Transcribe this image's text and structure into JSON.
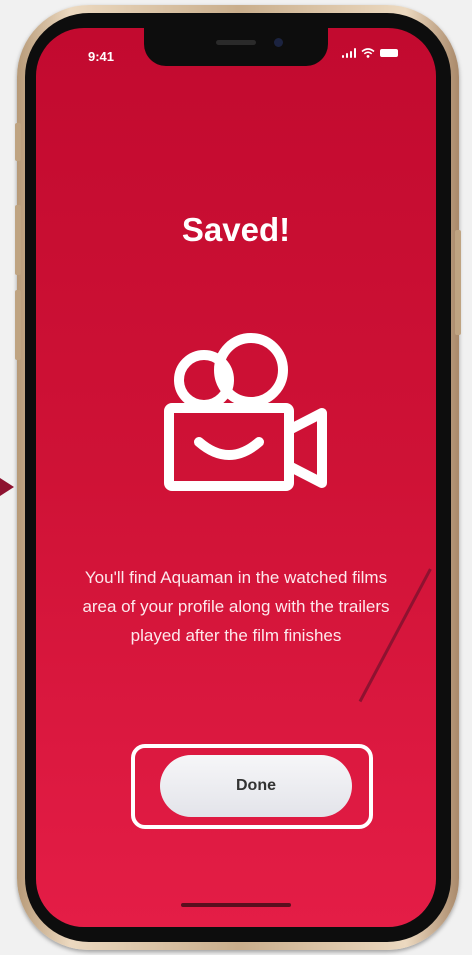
{
  "status_bar": {
    "time": "9:41"
  },
  "screen": {
    "title": "Saved!",
    "icon": "movie-camera-icon",
    "message": "You'll find Aquaman in the watched films area of your profile along with the trailers played after the film finishes",
    "done_label": "Done"
  },
  "colors": {
    "background_top": "#c20a2f",
    "background_bottom": "#e41d46",
    "annotation": "#8e1230",
    "button": "#ececf0"
  }
}
